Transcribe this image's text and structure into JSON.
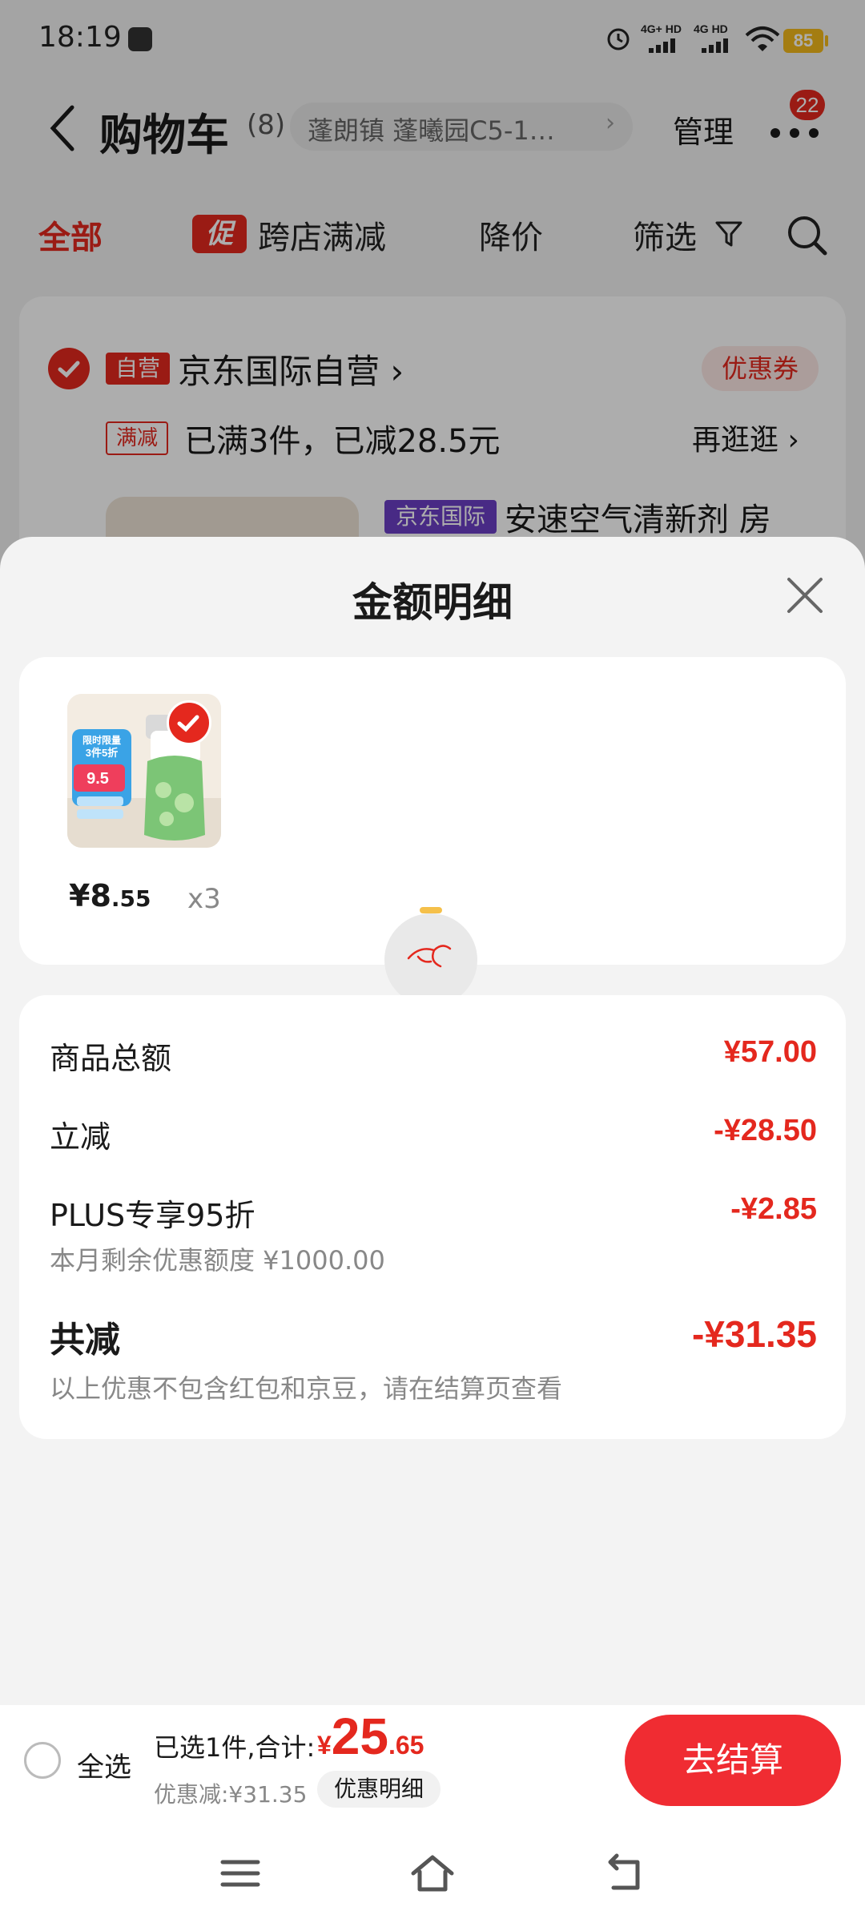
{
  "status_bar": {
    "time": "18:19",
    "sim1_label": "4G+ HD",
    "sim2_label": "4G HD",
    "battery": "85"
  },
  "header": {
    "title": "购物车",
    "count": "(8)",
    "address": "蓬朗镇 蓬曦园C5-1…",
    "manage_label": "管理",
    "badge": "22"
  },
  "tabs": {
    "all": "全部",
    "promo_chip": "促",
    "cross_store": "跨店满减",
    "price_drop": "降价",
    "filter": "筛选"
  },
  "store": {
    "self_badge": "自营",
    "name": "京东国际自营 ›",
    "coupon": "优惠券",
    "promo_tag": "满减",
    "promo_text": "已满3件，已减28.5元",
    "more_shopping": "再逛逛 ›",
    "intl_tag": "京东国际",
    "product_title": "安速空气清新剂 房"
  },
  "sheet": {
    "title": "金额明细",
    "item": {
      "price_int": "¥8",
      "price_dec": ".55",
      "qty": "x3",
      "image_texts": [
        "限时限量",
        "3件5折",
        "9.5"
      ]
    },
    "summary": {
      "goods_total_label": "商品总额",
      "goods_total_value": "¥57.00",
      "instant_label": "立减",
      "instant_value": "-¥28.50",
      "plus_label": "PLUS专享95折",
      "plus_value": "-¥2.85",
      "plus_sub": "本月剩余优惠额度 ¥1000.00",
      "total_label": "共减",
      "total_value": "-¥31.35",
      "total_note": "以上优惠不包含红包和京豆，请在结算页查看"
    }
  },
  "checkout": {
    "select_all": "全选",
    "selected_text": "已选1件,合计:",
    "total_currency": "¥",
    "total_int": "25",
    "total_dec": ".65",
    "discount_text": "优惠减:¥31.35",
    "detail_button": "优惠明细",
    "checkout_button": "去结算"
  },
  "colors": {
    "accent": "#e4281e",
    "checkout_button": "#f02c32",
    "intl_tag": "#6b3ec4"
  }
}
